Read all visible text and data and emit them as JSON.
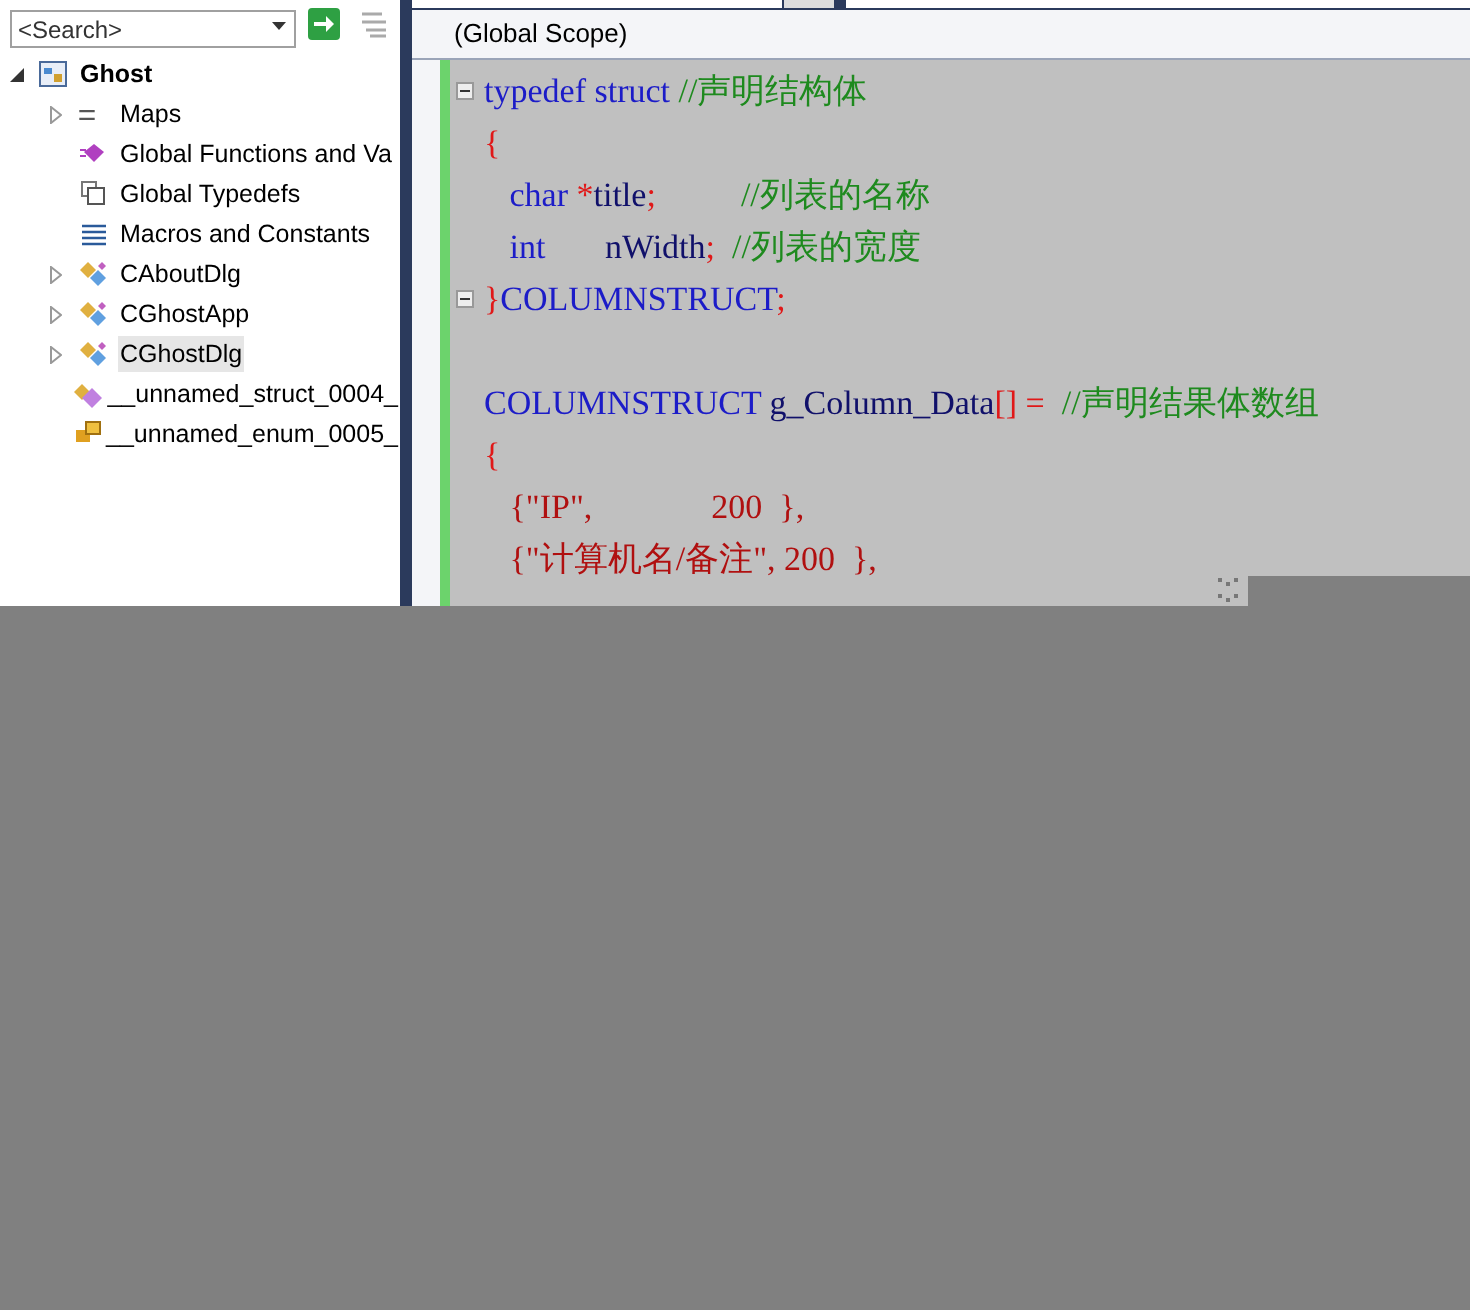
{
  "class_view": {
    "search": {
      "placeholder": "<Search>"
    },
    "tree": [
      {
        "label": "Ghost",
        "kind": "project",
        "expanded": true,
        "selected": false,
        "children": [
          {
            "label": "Maps",
            "kind": "map",
            "expanded": false,
            "selected": false
          },
          {
            "label": "Global Functions and Va",
            "kind": "function",
            "selected": false
          },
          {
            "label": "Global Typedefs",
            "kind": "typedef",
            "selected": false
          },
          {
            "label": "Macros and Constants",
            "kind": "macro",
            "selected": false
          },
          {
            "label": "CAboutDlg",
            "kind": "class",
            "expanded": false,
            "selected": false
          },
          {
            "label": "CGhostApp",
            "kind": "class",
            "expanded": false,
            "selected": false
          },
          {
            "label": "CGhostDlg",
            "kind": "class",
            "expanded": false,
            "selected": true
          },
          {
            "label": "__unnamed_struct_0004_",
            "kind": "struct",
            "selected": false
          },
          {
            "label": "__unnamed_enum_0005_",
            "kind": "enum",
            "selected": false
          }
        ]
      }
    ]
  },
  "editor": {
    "scope": "(Global Scope)",
    "lines": [
      {
        "foldable": true,
        "tokens": [
          {
            "kind": "keyword",
            "text": "typedef struct "
          },
          {
            "kind": "comment",
            "text": "//声明结构体"
          }
        ]
      },
      {
        "tokens": [
          {
            "kind": "punct",
            "text": "{"
          }
        ]
      },
      {
        "tokens": [
          {
            "kind": "keyword",
            "text": "   char "
          },
          {
            "kind": "punct",
            "text": "*"
          },
          {
            "kind": "ident",
            "text": "title"
          },
          {
            "kind": "punct",
            "text": ";"
          },
          {
            "kind": "comment",
            "text": "          //列表的名称"
          }
        ]
      },
      {
        "tokens": [
          {
            "kind": "keyword",
            "text": "   int       "
          },
          {
            "kind": "ident",
            "text": "nWidth"
          },
          {
            "kind": "punct",
            "text": ";"
          },
          {
            "kind": "comment",
            "text": "  //列表的宽度"
          }
        ]
      },
      {
        "foldable": true,
        "tokens": [
          {
            "kind": "punct",
            "text": "}"
          },
          {
            "kind": "keyword",
            "text": "COLUMNSTRUCT"
          },
          {
            "kind": "punct",
            "text": ";"
          }
        ]
      },
      {
        "blank": true
      },
      {
        "tokens": [
          {
            "kind": "keyword",
            "text": "COLUMNSTRUCT "
          },
          {
            "kind": "ident",
            "text": "g_Column_Data"
          },
          {
            "kind": "punct",
            "text": "[] = "
          },
          {
            "kind": "comment",
            "text": " //声明结果体数组"
          }
        ]
      },
      {
        "tokens": [
          {
            "kind": "punct",
            "text": "{"
          }
        ]
      },
      {
        "tokens": [
          {
            "kind": "string",
            "text": "   {\"IP\",              200  },"
          }
        ]
      },
      {
        "tokens": [
          {
            "kind": "string",
            "text": "   {\"计算机名/备注\", 200  },"
          }
        ]
      }
    ]
  }
}
